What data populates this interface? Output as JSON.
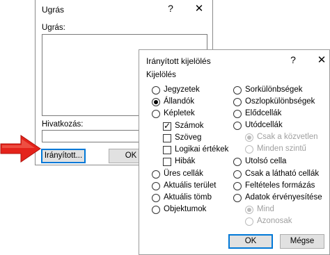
{
  "goto_dialog": {
    "title": "Ugrás",
    "help": "?",
    "close": "✕",
    "goto_label": "Ugrás:",
    "reference_label": "Hivatkozás:",
    "reference_value": "",
    "special_button": "Irányított...",
    "ok_button": "OK"
  },
  "special_dialog": {
    "title": "Irányított kijelölés",
    "help": "?",
    "close": "✕",
    "group_label": "Kijelölés",
    "left": {
      "jegyzetek": "Jegyzetek",
      "allandok": "Állandók",
      "kepletek": "Képletek",
      "szamok": "Számok",
      "szoveg": "Szöveg",
      "logikai": "Logikai értékek",
      "hibak": "Hibák",
      "ures": "Üres cellák",
      "aktualis_terulet": "Aktuális terület",
      "aktualis_tomb": "Aktuális tömb",
      "objektumok": "Objektumok"
    },
    "right": {
      "sorkulonbsegek": "Sorkülönbségek",
      "oszlopkulonbsegek": "Oszlopkülönbségek",
      "elodcellak": "Elődcellák",
      "utodcellak": "Utódcellák",
      "csak_kozvetlen": "Csak a közvetlen",
      "minden_szintu": "Minden szintű",
      "utolso_cella": "Utolsó cella",
      "lathato": "Csak a látható cellák",
      "felteteles": "Feltételes formázás",
      "adatok_ervenyesitese": "Adatok érvényesítése",
      "mind": "Mind",
      "azonosak": "Azonosak"
    },
    "ok_button": "OK",
    "cancel_button": "Mégse"
  },
  "colors": {
    "focus_border": "#0078d7",
    "pointer_red": "#e4231b"
  }
}
